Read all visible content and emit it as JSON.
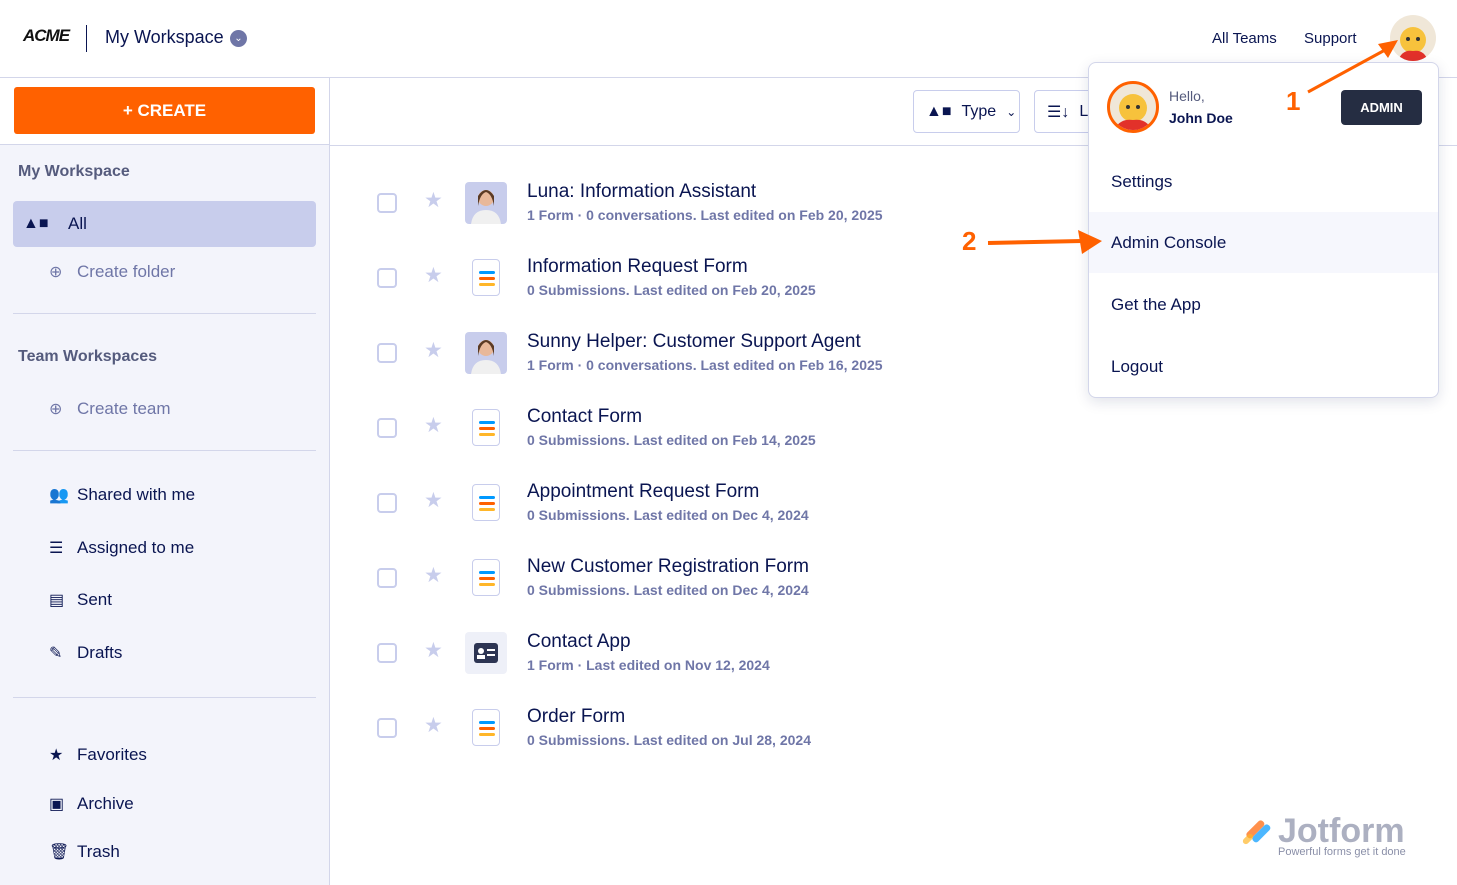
{
  "header": {
    "logo": "ACME",
    "workspace": "My Workspace",
    "links": [
      "All Teams",
      "Support"
    ]
  },
  "sidebar": {
    "create_label": "+ CREATE",
    "my_workspace": "My Workspace",
    "all": "All",
    "create_folder": "Create folder",
    "team_workspaces": "Team Workspaces",
    "create_team": "Create team",
    "items": [
      "Shared with me",
      "Assigned to me",
      "Sent",
      "Drafts"
    ],
    "bottom": [
      "Favorites",
      "Archive",
      "Trash"
    ]
  },
  "toolbar": {
    "type_label": "Type",
    "sort_label": "La"
  },
  "list": [
    {
      "title": "Luna: Information Assistant",
      "sub": "1 Form · 0 conversations. Last edited on Feb 20, 2025",
      "kind": "person"
    },
    {
      "title": "Information Request Form",
      "sub": "0 Submissions. Last edited on Feb 20, 2025",
      "kind": "form"
    },
    {
      "title": "Sunny Helper: Customer Support Agent",
      "sub": "1 Form · 0 conversations. Last edited on Feb 16, 2025",
      "kind": "person"
    },
    {
      "title": "Contact Form",
      "sub": "0 Submissions. Last edited on Feb 14, 2025",
      "kind": "form"
    },
    {
      "title": "Appointment Request Form",
      "sub": "0 Submissions. Last edited on Dec 4, 2024",
      "kind": "form"
    },
    {
      "title": "New Customer Registration Form",
      "sub": "0 Submissions. Last edited on Dec 4, 2024",
      "kind": "form"
    },
    {
      "title": "Contact App",
      "sub": "1 Form · Last edited on Nov 12, 2024",
      "kind": "app"
    },
    {
      "title": "Order Form",
      "sub": "0 Submissions. Last edited on Jul 28, 2024",
      "kind": "form"
    }
  ],
  "menu": {
    "hello": "Hello,",
    "name": "John Doe",
    "badge": "ADMIN",
    "items": [
      "Settings",
      "Admin Console",
      "Get the App",
      "Logout"
    ]
  },
  "annotations": [
    "1",
    "2"
  ],
  "brand": {
    "name": "Jotform",
    "tagline": "Powerful forms get it done"
  },
  "colors": {
    "accent": "#ff6100",
    "text": "#0a1551",
    "muted": "#6f76a7"
  }
}
